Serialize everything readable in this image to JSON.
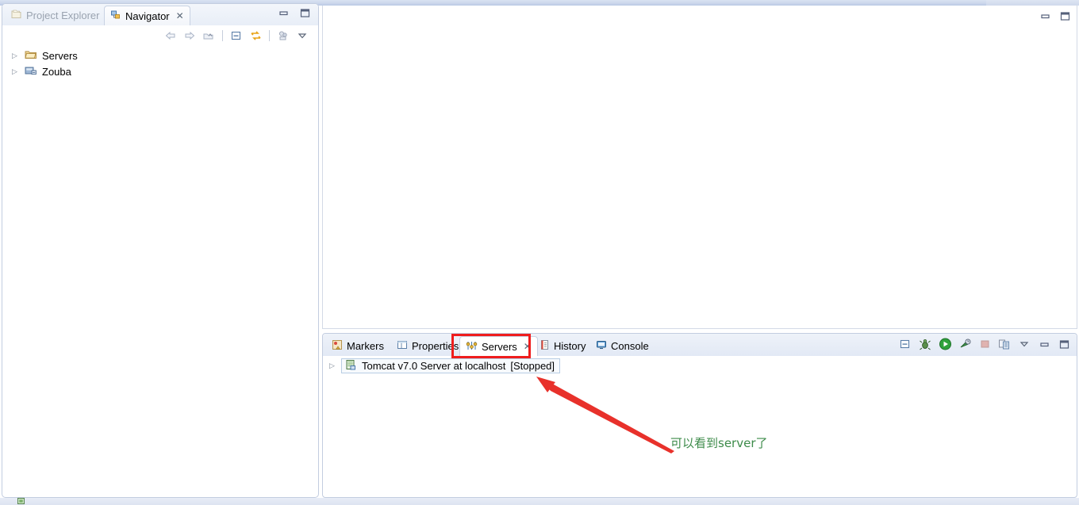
{
  "window": {
    "minimize_glyph": "—",
    "maximize_glyph": "❐"
  },
  "left_view": {
    "tabs": [
      {
        "label": "Project Explorer",
        "icon": "project-explorer-icon",
        "active": false,
        "closable": false
      },
      {
        "label": "Navigator",
        "icon": "navigator-icon",
        "active": true,
        "closable": true,
        "close_glyph": "✕"
      }
    ],
    "toolbar": [
      {
        "name": "back-icon",
        "tooltip": "Back"
      },
      {
        "name": "forward-icon",
        "tooltip": "Forward"
      },
      {
        "name": "up-icon",
        "tooltip": "Up"
      },
      {
        "name": "collapse-all-icon",
        "tooltip": "Collapse All"
      },
      {
        "name": "link-with-editor-icon",
        "tooltip": "Link with Editor"
      },
      {
        "name": "view-filter-icon",
        "tooltip": "Filters"
      },
      {
        "name": "view-menu-icon",
        "tooltip": "View Menu"
      }
    ],
    "tree": [
      {
        "label": "Servers",
        "icon": "folder-icon",
        "expanded": false,
        "twisty": "▷"
      },
      {
        "label": "Zouba",
        "icon": "project-icon",
        "expanded": false,
        "twisty": "▷"
      }
    ]
  },
  "editor_area": {
    "content": "",
    "minimize_glyph": "—",
    "maximize_glyph": "❐"
  },
  "bottom_view": {
    "tabs": [
      {
        "label": "Markers",
        "icon": "markers-icon",
        "active": false,
        "closable": false
      },
      {
        "label": "Properties",
        "icon": "properties-icon",
        "active": false,
        "closable": false
      },
      {
        "label": "Servers",
        "icon": "servers-icon",
        "active": true,
        "closable": true,
        "close_glyph": "✕"
      },
      {
        "label": "History",
        "icon": "history-icon",
        "active": false,
        "closable": false
      },
      {
        "label": "Console",
        "icon": "console-icon",
        "active": false,
        "closable": false
      }
    ],
    "toolbar": [
      {
        "name": "collapse-all-icon",
        "tooltip": "Collapse All"
      },
      {
        "name": "debug-icon",
        "tooltip": "Start the server in debug mode"
      },
      {
        "name": "start-icon",
        "tooltip": "Start the server"
      },
      {
        "name": "profile-icon",
        "tooltip": "Start the server in profiling mode"
      },
      {
        "name": "stop-icon",
        "tooltip": "Stop the server",
        "disabled": true
      },
      {
        "name": "publish-icon",
        "tooltip": "Publish to the server"
      },
      {
        "name": "view-menu-icon",
        "tooltip": "View Menu"
      },
      {
        "name": "minimize-icon",
        "tooltip": "Minimize"
      },
      {
        "name": "maximize-icon",
        "tooltip": "Maximize"
      }
    ],
    "servers": [
      {
        "name": "Tomcat v7.0 Server at localhost",
        "state": "[Stopped]",
        "icon": "tomcat-server-icon",
        "twisty": "▷",
        "selected": true
      }
    ]
  },
  "annotations": {
    "highlight_color": "#ef1d1d",
    "arrow_color": "#e8312b",
    "note_color": "#3d8b4a",
    "note_text": "可以看到server了"
  },
  "status_bar": {
    "icon": "status-indicator-icon"
  }
}
